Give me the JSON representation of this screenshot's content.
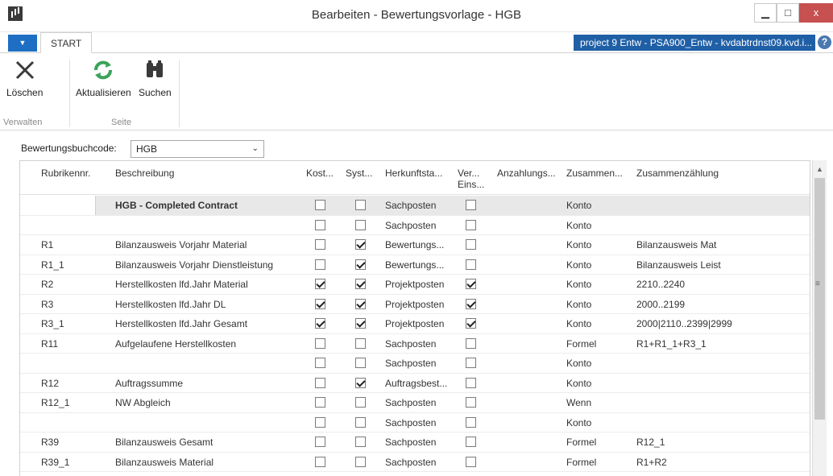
{
  "window": {
    "title": "Bearbeiten - Bewertungsvorlage - HGB",
    "minimize": "▁",
    "maximize": "□",
    "close": "x"
  },
  "ribbon": {
    "tab_dropdown": "▼",
    "tab_start": "START",
    "server": "project 9 Entw - PSA900_Entw - kvdabtrdnst09.kvd.i...",
    "help": "?",
    "buttons": {
      "delete": "Löschen",
      "refresh": "Aktualisieren",
      "search": "Suchen"
    },
    "groups": {
      "manage": "Verwalten",
      "page": "Seite"
    }
  },
  "filter": {
    "label": "Bewertungsbuchcode:",
    "value": "HGB"
  },
  "columns": {
    "rubrik": "Rubrikennr.",
    "beschreibung": "Beschreibung",
    "kost": "Kost...",
    "syst": "Syst...",
    "herkunft": "Herkunftsta...",
    "vereins_1": "Ver...",
    "vereins_2": "Eins...",
    "anzahlung": "Anzahlungs...",
    "zusammen_short": "Zusammen...",
    "zusammenzaehlung": "Zusammenzählung"
  },
  "rows": [
    {
      "rubrik": "",
      "beschreibung": "HGB - Completed Contract",
      "kost": false,
      "syst": false,
      "herkunft": "Sachposten",
      "ver": false,
      "zus": "Konto",
      "zsum": "",
      "selected": true,
      "bold": true
    },
    {
      "rubrik": "",
      "beschreibung": "",
      "kost": false,
      "syst": false,
      "herkunft": "Sachposten",
      "ver": false,
      "zus": "Konto",
      "zsum": ""
    },
    {
      "rubrik": "R1",
      "beschreibung": "Bilanzausweis Vorjahr Material",
      "kost": false,
      "syst": true,
      "herkunft": "Bewertungs...",
      "ver": false,
      "zus": "Konto",
      "zsum": "Bilanzausweis Mat"
    },
    {
      "rubrik": "R1_1",
      "beschreibung": "Bilanzausweis Vorjahr Dienstleistung",
      "kost": false,
      "syst": true,
      "herkunft": "Bewertungs...",
      "ver": false,
      "zus": "Konto",
      "zsum": "Bilanzausweis Leist"
    },
    {
      "rubrik": "R2",
      "beschreibung": "Herstellkosten lfd.Jahr Material",
      "kost": true,
      "syst": true,
      "herkunft": "Projektposten",
      "ver": true,
      "zus": "Konto",
      "zsum": "2210..2240"
    },
    {
      "rubrik": "R3",
      "beschreibung": "Herstellkosten lfd.Jahr DL",
      "kost": true,
      "syst": true,
      "herkunft": "Projektposten",
      "ver": true,
      "zus": "Konto",
      "zsum": "2000..2199"
    },
    {
      "rubrik": "R3_1",
      "beschreibung": "Herstellkosten lfd.Jahr Gesamt",
      "kost": true,
      "syst": true,
      "herkunft": "Projektposten",
      "ver": true,
      "zus": "Konto",
      "zsum": "2000|2110..2399|2999"
    },
    {
      "rubrik": "R11",
      "beschreibung": "Aufgelaufene Herstellkosten",
      "kost": false,
      "syst": false,
      "herkunft": "Sachposten",
      "ver": false,
      "zus": "Formel",
      "zsum": "R1+R1_1+R3_1"
    },
    {
      "rubrik": "",
      "beschreibung": "",
      "kost": false,
      "syst": false,
      "herkunft": "Sachposten",
      "ver": false,
      "zus": "Konto",
      "zsum": ""
    },
    {
      "rubrik": "R12",
      "beschreibung": "Auftragssumme",
      "kost": false,
      "syst": true,
      "herkunft": "Auftragsbest...",
      "ver": false,
      "zus": "Konto",
      "zsum": ""
    },
    {
      "rubrik": "R12_1",
      "beschreibung": "NW Abgleich",
      "kost": false,
      "syst": false,
      "herkunft": "Sachposten",
      "ver": false,
      "zus": "Wenn",
      "zsum": ""
    },
    {
      "rubrik": "",
      "beschreibung": "",
      "kost": false,
      "syst": false,
      "herkunft": "Sachposten",
      "ver": false,
      "zus": "Konto",
      "zsum": ""
    },
    {
      "rubrik": "R39",
      "beschreibung": "Bilanzausweis Gesamt",
      "kost": false,
      "syst": false,
      "herkunft": "Sachposten",
      "ver": false,
      "zus": "Formel",
      "zsum": "R12_1"
    },
    {
      "rubrik": "R39_1",
      "beschreibung": "Bilanzausweis Material",
      "kost": false,
      "syst": false,
      "herkunft": "Sachposten",
      "ver": false,
      "zus": "Formel",
      "zsum": "R1+R2"
    }
  ],
  "scrollbar": {
    "up_arrow": "▲",
    "grip": "≡"
  }
}
